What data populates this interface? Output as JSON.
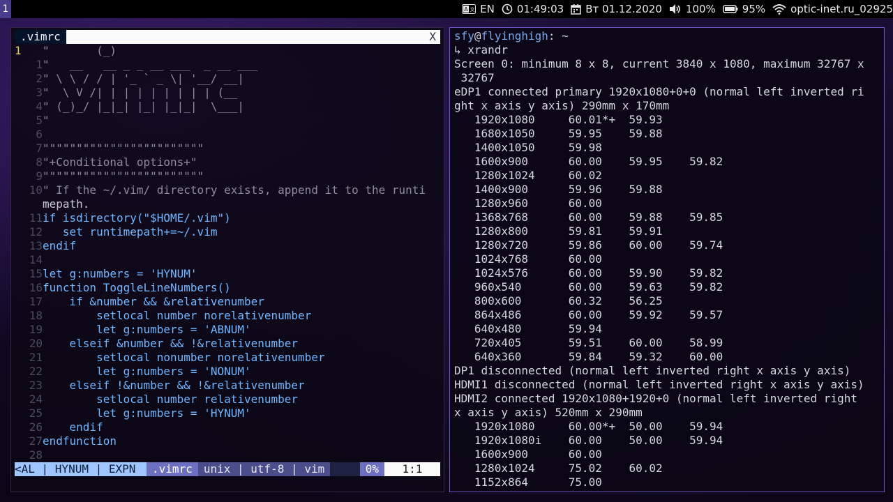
{
  "topbar": {
    "workspace": "1",
    "lang_indicator": "EN",
    "time": "01:49:03",
    "date": "Вт 01.12.2020",
    "volume": "100%",
    "battery": "95%",
    "network": "optic-inet.ru_02925"
  },
  "colors": {
    "accent": "#6a5acd",
    "workspace_bg": "#4a3c8c",
    "terminal_prompt": "#7aa9e8",
    "vim_string": "#f2d15a",
    "vim_keyword": "#6fb7ff"
  },
  "vim": {
    "tab_label": ".vimrc",
    "tab_close": "X",
    "lines": [
      {
        "n": "1",
        "current": true,
        "text": "\"       (_)"
      },
      {
        "n": "1",
        "text": "\"   __   __ _ _ __ ___  _ __ ___"
      },
      {
        "n": "2",
        "text": "\" \\ \\ / / | '_ ` _ \\| '__/ __|"
      },
      {
        "n": "3",
        "text": "\"  \\ V /| | | | | | | | | (__"
      },
      {
        "n": "4",
        "text": "\" (_)_/ |_|_| |_| |_|_|  \\___|"
      },
      {
        "n": "5",
        "text": "\""
      },
      {
        "n": "6",
        "text": ""
      },
      {
        "n": "7",
        "text": "\"\"\"\"\"\"\"\"\"\"\"\"\"\"\"\"\"\"\"\"\"\"\"\""
      },
      {
        "n": "8",
        "text": "\"+Conditional options+\""
      },
      {
        "n": "9",
        "text": "\"\"\"\"\"\"\"\"\"\"\"\"\"\"\"\"\"\"\"\"\"\"\"\""
      },
      {
        "n": "10",
        "text": "\" If the ~/.vim/ directory exists, append it to the runti"
      },
      {
        "n": "",
        "text": "mepath."
      },
      {
        "n": "11",
        "text": "if isdirectory(\"$HOME/.vim\")"
      },
      {
        "n": "12",
        "text": "   set runtimepath+=~/.vim"
      },
      {
        "n": "13",
        "text": "endif"
      },
      {
        "n": "14",
        "text": ""
      },
      {
        "n": "15",
        "text": "let g:numbers = 'HYNUM'"
      },
      {
        "n": "16",
        "text": "function ToggleLineNumbers()"
      },
      {
        "n": "17",
        "text": "    if &number && &relativenumber"
      },
      {
        "n": "18",
        "text": "        setlocal number norelativenumber"
      },
      {
        "n": "19",
        "text": "        let g:numbers = 'ABNUM'"
      },
      {
        "n": "20",
        "text": "    elseif &number && !&relativenumber"
      },
      {
        "n": "21",
        "text": "        setlocal nonumber norelativenumber"
      },
      {
        "n": "22",
        "text": "        let g:numbers = 'NONUM'"
      },
      {
        "n": "23",
        "text": "    elseif !&number && !&relativenumber"
      },
      {
        "n": "24",
        "text": "        setlocal number relativenumber"
      },
      {
        "n": "25",
        "text": "        let g:numbers = 'HYNUM'"
      },
      {
        "n": "26",
        "text": "    endif"
      },
      {
        "n": "27",
        "text": "endfunction"
      },
      {
        "n": "28",
        "text": ""
      }
    ],
    "status": {
      "mode": "<AL | HYNUM | EXPN ",
      "file": ".vimrc",
      "format": "unix | utf-8 | vim",
      "percent": "0%",
      "position": "1:1"
    }
  },
  "terminal": {
    "prompt_user": "sfy",
    "prompt_at": "@",
    "prompt_host": "flyinghigh",
    "prompt_path": ": ~",
    "command_line": "↳ xrandr",
    "output": [
      "Screen 0: minimum 8 x 8, current 3840 x 1080, maximum 32767 x",
      " 32767",
      "eDP1 connected primary 1920x1080+0+0 (normal left inverted ri",
      "ght x axis y axis) 290mm x 170mm",
      "   1920x1080     60.01*+  59.93",
      "   1680x1050     59.95    59.88",
      "   1400x1050     59.98",
      "   1600x900      60.00    59.95    59.82",
      "   1280x1024     60.02",
      "   1400x900      59.96    59.88",
      "   1280x960      60.00",
      "   1368x768      60.00    59.88    59.85",
      "   1280x800      59.81    59.91",
      "   1280x720      59.86    60.00    59.74",
      "   1024x768      60.00",
      "   1024x576      60.00    59.90    59.82",
      "   960x540       60.00    59.63    59.82",
      "   800x600       60.32    56.25",
      "   864x486       60.00    59.92    59.57",
      "   640x480       59.94",
      "   720x405       59.51    60.00    58.99",
      "   640x360       59.84    59.32    60.00",
      "DP1 disconnected (normal left inverted right x axis y axis)",
      "HDMI1 disconnected (normal left inverted right x axis y axis)",
      "HDMI2 connected 1920x1080+1920+0 (normal left inverted right",
      "x axis y axis) 520mm x 290mm",
      "   1920x1080     60.00*+  50.00    59.94",
      "   1920x1080i    60.00    50.00    59.94",
      "   1600x900      60.00",
      "   1280x1024     75.02    60.02",
      "   1152x864      75.00"
    ]
  }
}
